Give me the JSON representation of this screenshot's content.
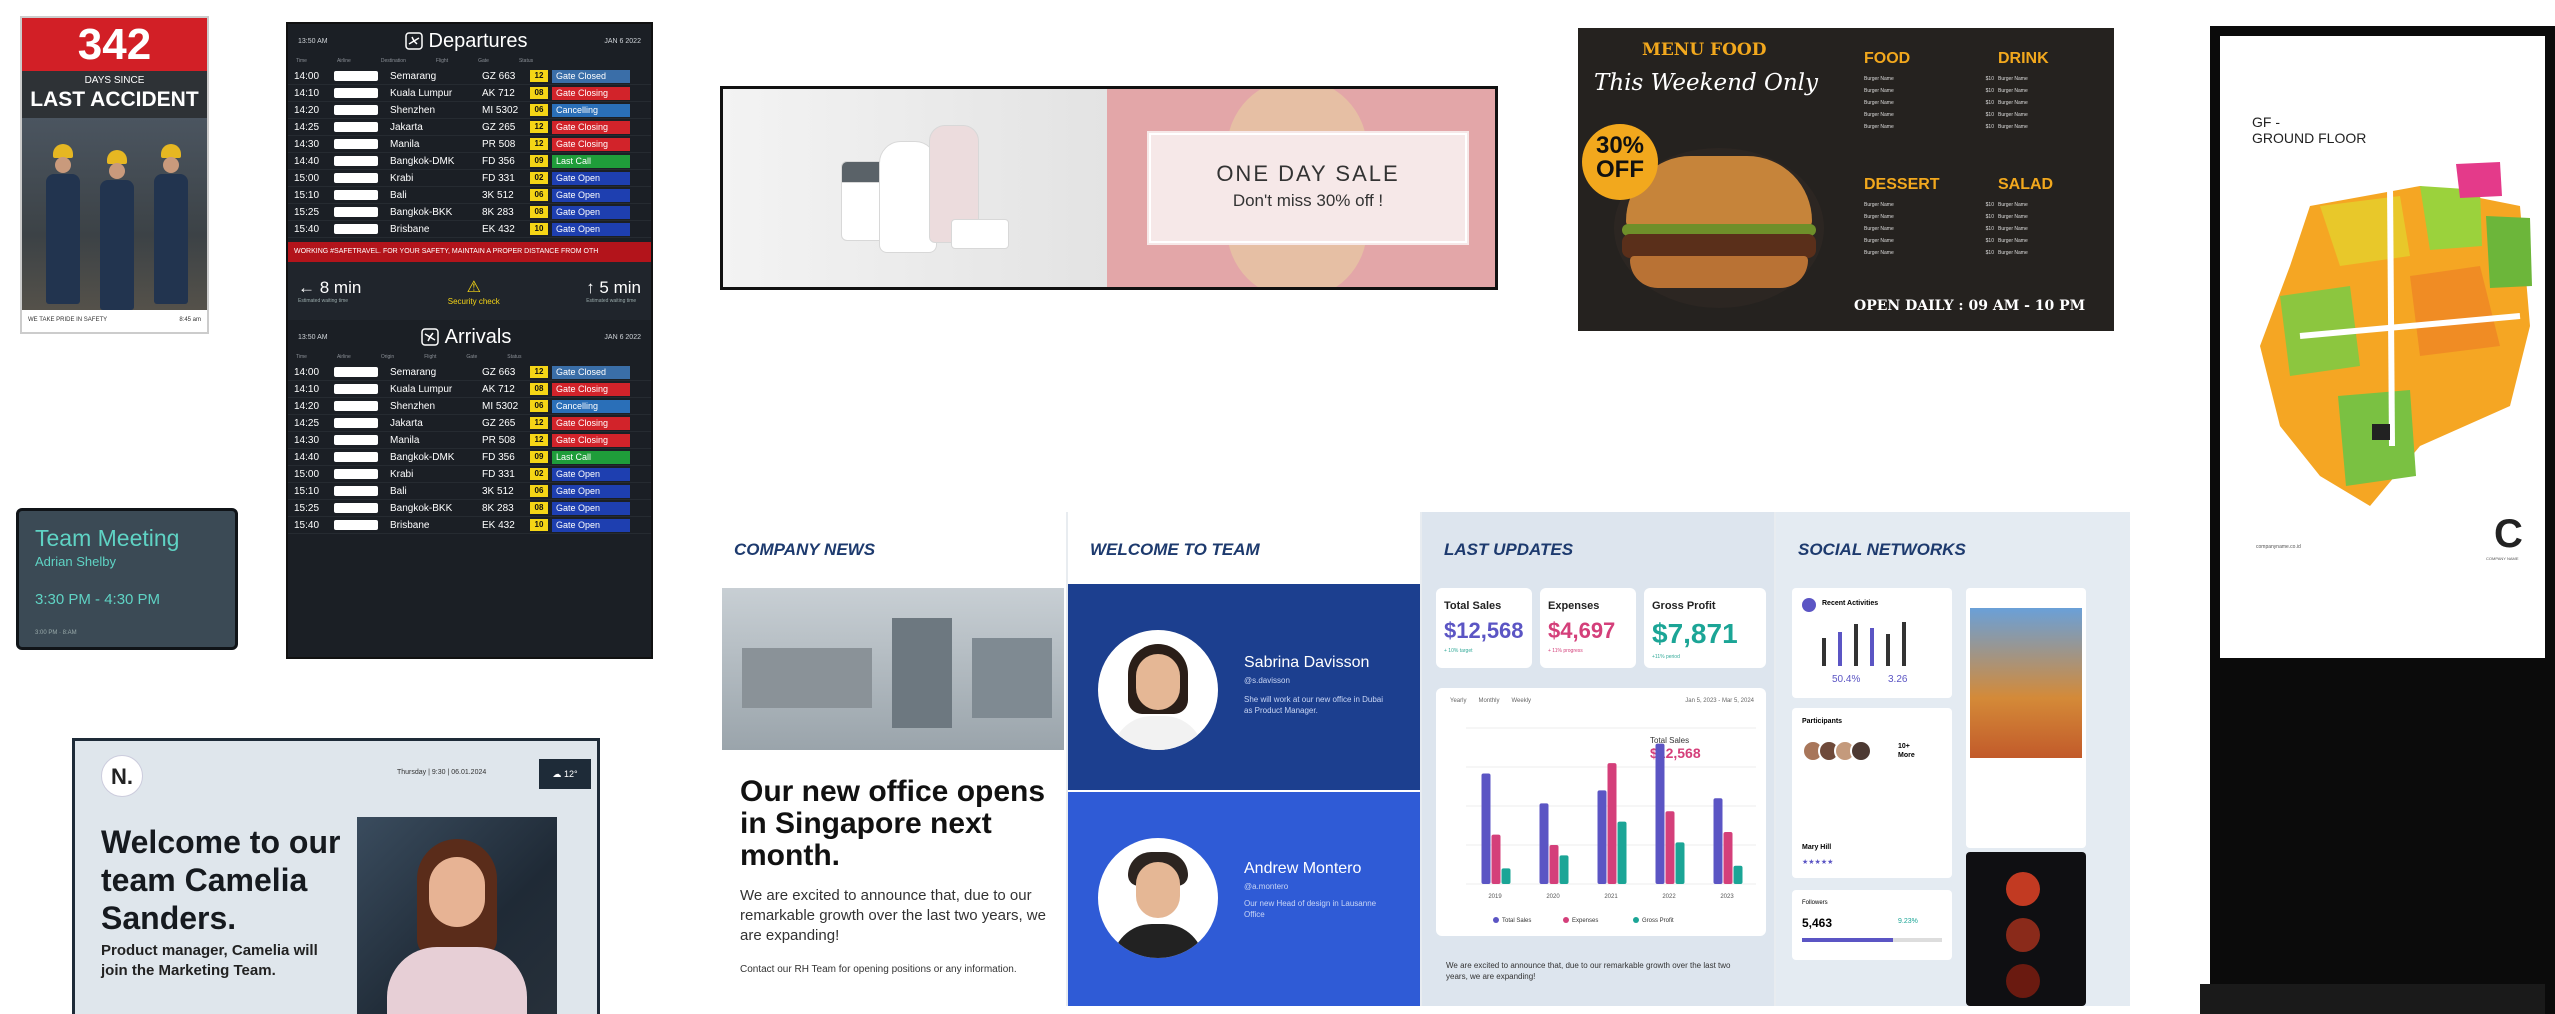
{
  "accident": {
    "count": "342",
    "sub": "DAYS SINCE",
    "label": "LAST ACCIDENT",
    "footer_left": "WE TAKE PRIDE IN SAFETY",
    "footer_right": "8:45 am"
  },
  "departures": {
    "time": "13:50 AM",
    "title": "Departures",
    "date": "JAN 6 2022",
    "rows": [
      {
        "t": "14:00",
        "c": "Semarang",
        "f": "GZ 663",
        "g": "12",
        "s": "Gate Closed",
        "col": "#3a6ea8"
      },
      {
        "t": "14:10",
        "c": "Kuala Lumpur",
        "f": "AK 712",
        "g": "08",
        "s": "Gate Closing",
        "col": "#d2232a"
      },
      {
        "t": "14:20",
        "c": "Shenzhen",
        "f": "MI 5302",
        "g": "06",
        "s": "Cancelling",
        "col": "#2a6fb8"
      },
      {
        "t": "14:25",
        "c": "Jakarta",
        "f": "GZ 265",
        "g": "12",
        "s": "Gate Closing",
        "col": "#d2232a"
      },
      {
        "t": "14:30",
        "c": "Manila",
        "f": "PR 508",
        "g": "12",
        "s": "Gate Closing",
        "col": "#d2232a"
      },
      {
        "t": "14:40",
        "c": "Bangkok-DMK",
        "f": "FD 356",
        "g": "09",
        "s": "Last Call",
        "col": "#1f9d3a"
      },
      {
        "t": "15:00",
        "c": "Krabi",
        "f": "FD 331",
        "g": "02",
        "s": "Gate Open",
        "col": "#1e3fb0"
      },
      {
        "t": "15:10",
        "c": "Bali",
        "f": "3K 512",
        "g": "06",
        "s": "Gate Open",
        "col": "#1e3fb0"
      },
      {
        "t": "15:25",
        "c": "Bangkok-BKK",
        "f": "8K 283",
        "g": "08",
        "s": "Gate Open",
        "col": "#1e3fb0"
      },
      {
        "t": "15:40",
        "c": "Brisbane",
        "f": "EK 432",
        "g": "10",
        "s": "Gate Open",
        "col": "#1e3fb0"
      }
    ],
    "ticker": "WORKING #SAFETRAVEL. FOR YOUR SAFETY, MAINTAIN A PROPER DISTANCE FROM OTH",
    "left_min": "8 min",
    "security": "Security check",
    "right_min": "5 min",
    "arr_title": "Arrivals",
    "arrivals": [
      {
        "t": "14:00",
        "c": "Semarang",
        "f": "GZ 663",
        "g": "12",
        "s": "Gate Closed",
        "col": "#3a6ea8"
      },
      {
        "t": "14:10",
        "c": "Kuala Lumpur",
        "f": "AK 712",
        "g": "08",
        "s": "Gate Closing",
        "col": "#d2232a"
      },
      {
        "t": "14:20",
        "c": "Shenzhen",
        "f": "MI 5302",
        "g": "06",
        "s": "Cancelling",
        "col": "#2a6fb8"
      },
      {
        "t": "14:25",
        "c": "Jakarta",
        "f": "GZ 265",
        "g": "12",
        "s": "Gate Closing",
        "col": "#d2232a"
      },
      {
        "t": "14:30",
        "c": "Manila",
        "f": "PR 508",
        "g": "12",
        "s": "Gate Closing",
        "col": "#d2232a"
      },
      {
        "t": "14:40",
        "c": "Bangkok-DMK",
        "f": "FD 356",
        "g": "09",
        "s": "Last Call",
        "col": "#1f9d3a"
      },
      {
        "t": "15:00",
        "c": "Krabi",
        "f": "FD 331",
        "g": "02",
        "s": "Gate Open",
        "col": "#1e3fb0"
      },
      {
        "t": "15:10",
        "c": "Bali",
        "f": "3K 512",
        "g": "06",
        "s": "Gate Open",
        "col": "#1e3fb0"
      },
      {
        "t": "15:25",
        "c": "Bangkok-BKK",
        "f": "8K 283",
        "g": "08",
        "s": "Gate Open",
        "col": "#1e3fb0"
      },
      {
        "t": "15:40",
        "c": "Brisbane",
        "f": "EK 432",
        "g": "10",
        "s": "Gate Open",
        "col": "#1e3fb0"
      }
    ]
  },
  "team_meeting": {
    "title": "Team Meeting",
    "name": "Adrian Shelby",
    "time": "3:30 PM - 4:30 PM",
    "footer": "3:00 PM · 8:AM"
  },
  "welcome": {
    "logo": "N.",
    "date": "Thursday | 9:30 | 06.01.2024",
    "temp": "12°",
    "title": "Welcome to our team Camelia Sanders.",
    "desc": "Product manager, Camelia will join the Marketing Team."
  },
  "sale": {
    "title": "ONE DAY SALE",
    "sub": "Don't miss 30% off !"
  },
  "menu": {
    "brand": "MENU FOOD",
    "tagline": "This Weekend Only",
    "off1": "30%",
    "off2": "OFF",
    "food": "FOOD",
    "drink": "DRINK",
    "dessert": "DESSERT",
    "salad": "SALAD",
    "item": "Burger Name",
    "price": "$10",
    "hours": "OPEN DAILY : 09 AM - 10 PM"
  },
  "map": {
    "floor1": "GF -",
    "floor2": "GROUND FLOOR",
    "logo": "C",
    "logo_sub": "COMPANY NAME",
    "footer": "companyname.co.id"
  },
  "dashboard": {
    "company_news": "COMPANY NEWS",
    "headline": "Our new office opens in Singapore next month.",
    "body": "We are excited to announce that, due to our remarkable growth over the last two years, we are expanding!",
    "cta": "Contact our RH Team for opening positions or any information.",
    "welcome_team": "WELCOME TO TEAM",
    "p1_name": "Sabrina Davisson",
    "p1_handle": "@s.davisson",
    "p1_desc": "She will work at our new office in Dubai as Product Manager.",
    "p2_name": "Andrew Montero",
    "p2_handle": "@a.montero",
    "p2_desc": "Our new Head of design in Lausanne Office",
    "last_updates": "LAST UPDATES",
    "ts_label": "Total Sales",
    "ts_value": "$12,568",
    "ts_sub": "+ 10% target",
    "ex_label": "Expenses",
    "ex_value": "$4,697",
    "ex_sub": "+ 11% progress",
    "gp_label": "Gross Profit",
    "gp_value": "$7,871",
    "gp_sub": "+11% period",
    "chart_tabs": [
      "Yearly",
      "Monthly",
      "Weekly"
    ],
    "chart_range": "Jan 5, 2023 - Mar 5, 2024",
    "chart_callout_label": "Total Sales",
    "chart_callout_value": "$12,568",
    "caption": "We are excited to announce that, due to our remarkable growth over the last two years, we are expanding!",
    "social": "SOCIAL NETWORKS",
    "recent": "Recent Activities",
    "pct1": "50.4%",
    "pct2": "3.26",
    "participants": "Participants",
    "more": "10+ More",
    "host": "Mary Hill",
    "followers": "Followers",
    "followers_value": "5,463",
    "followers_growth": "9.23%"
  },
  "chart_data": {
    "type": "bar",
    "categories": [
      "2019",
      "2020",
      "2021",
      "2022",
      "2023"
    ],
    "series": [
      {
        "name": "Total Sales",
        "values": [
          85,
          62,
          72,
          108,
          66
        ],
        "color": "#5b55c4"
      },
      {
        "name": "Expenses",
        "values": [
          38,
          30,
          93,
          56,
          40
        ],
        "color": "#d43f7a"
      },
      {
        "name": "Gross Profit",
        "values": [
          12,
          22,
          48,
          32,
          14
        ],
        "color": "#1ba596"
      }
    ],
    "ylim": [
      0,
      120
    ],
    "legend": "bottom"
  },
  "colors": {
    "navy": "#1d3a6e",
    "blue": "#2f5bd6",
    "pink": "#d43f7a",
    "teal": "#1ba596",
    "orange": "#f2a81d",
    "red": "#d2232a"
  }
}
